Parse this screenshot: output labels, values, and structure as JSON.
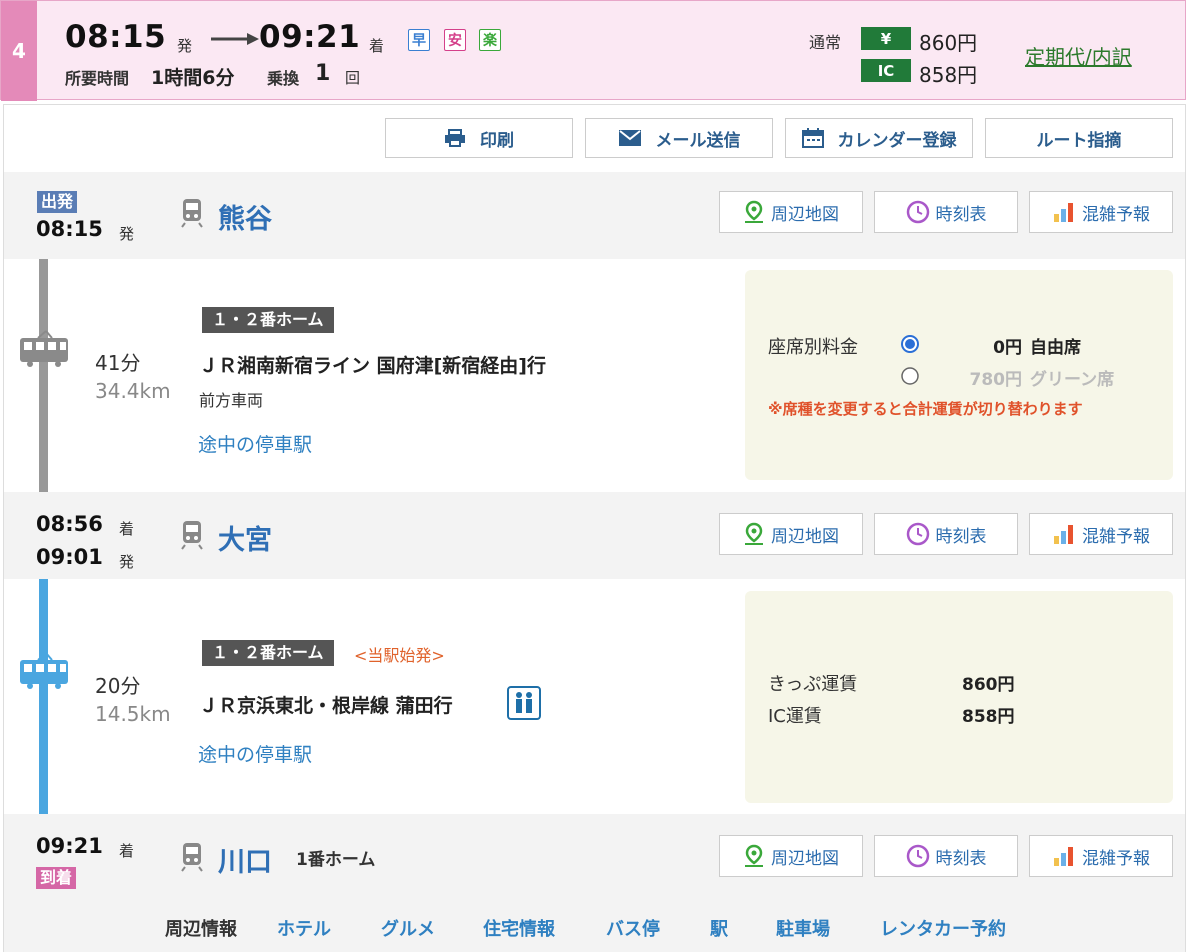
{
  "summary": {
    "route_number": "4",
    "depart_time": "08:15",
    "depart_suffix": "発",
    "arrive_time": "09:21",
    "arrive_suffix": "着",
    "badges": [
      {
        "label": "早",
        "color": "#3a7fd1"
      },
      {
        "label": "安",
        "color": "#d4408a"
      },
      {
        "label": "楽",
        "color": "#3aa83a"
      }
    ],
    "duration_label": "所要時間",
    "duration_value": "1時間6分",
    "transfer_label": "乗換",
    "transfer_count": "1",
    "transfer_unit": "回",
    "fare_label": "通常",
    "fare_yen_tag": "¥",
    "fare_yen_value": "860円",
    "fare_ic_tag": "IC",
    "fare_ic_value": "858円",
    "commuter_link": "定期代/内訳"
  },
  "toolbar": {
    "print": "印刷",
    "mail": "メール送信",
    "calendar": "カレンダー登録",
    "report": "ルート指摘"
  },
  "station_buttons": {
    "map": "周辺地図",
    "timetable": "時刻表",
    "congestion": "混雑予報"
  },
  "stations": [
    {
      "badge": "出発",
      "time1": "08:15",
      "suffix1": "発",
      "name": "熊谷"
    },
    {
      "time1": "08:56",
      "suffix1": "着",
      "time2": "09:01",
      "suffix2": "発",
      "name": "大宮"
    },
    {
      "time1": "09:21",
      "suffix1": "着",
      "badge": "到着",
      "name": "川口",
      "platform": "1番ホーム"
    }
  ],
  "legs": [
    {
      "platform": "１・２番ホーム",
      "duration": "41分",
      "distance": "34.4km",
      "line": "ＪＲ湘南新宿ライン 国府津[新宿経由]行",
      "car_position": "前方車両",
      "stops_link": "途中の停車駅",
      "line_color": "#999999",
      "fare": {
        "seat_label": "座席別料金",
        "options": [
          {
            "price": "0円",
            "name": "自由席",
            "selected": true
          },
          {
            "price": "780円",
            "name": "グリーン席",
            "selected": false
          }
        ],
        "note": "※席種を変更すると合計運賃が切り替わります"
      }
    },
    {
      "platform": "１・２番ホーム",
      "origin_note": "<当駅始発>",
      "duration": "20分",
      "distance": "14.5km",
      "line": "ＪＲ京浜東北・根岸線 蒲田行",
      "stops_link": "途中の停車駅",
      "line_color": "#4aa6e0",
      "fare": {
        "ticket_label": "きっぷ運賃",
        "ticket_value": "860円",
        "ic_label": "IC運賃",
        "ic_value": "858円"
      }
    }
  ],
  "nearby": {
    "label": "周辺情報",
    "links": [
      "ホテル",
      "グルメ",
      "住宅情報",
      "バス停",
      "駅",
      "駐車場",
      "レンタカー予約"
    ]
  }
}
